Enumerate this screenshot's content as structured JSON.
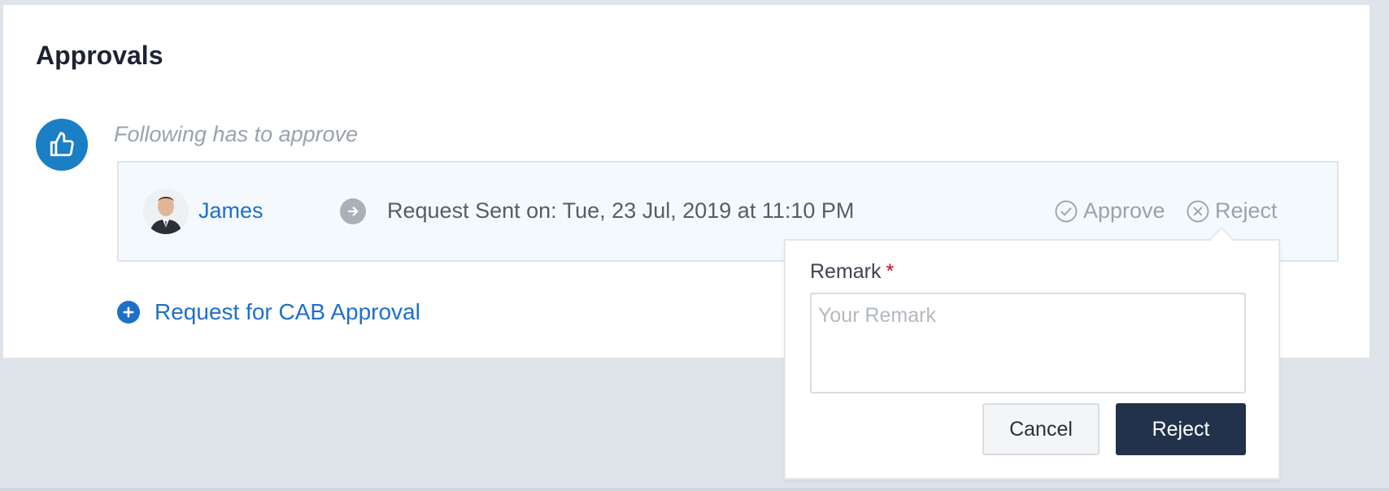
{
  "section": {
    "title": "Approvals",
    "hint": "Following has to approve"
  },
  "approval": {
    "approver_name": "James",
    "request_sent": "Request Sent on: Tue, 23 Jul, 2019 at 11:10 PM",
    "approve_label": "Approve",
    "reject_label": "Reject"
  },
  "add_request": {
    "label": "Request for CAB Approval"
  },
  "reject_popover": {
    "remark_label": "Remark",
    "required_mark": "*",
    "remark_placeholder": "Your Remark",
    "remark_value": "",
    "cancel_label": "Cancel",
    "reject_label": "Reject"
  },
  "icons": {
    "approval_icon": "thumbs-up-icon",
    "arrow_icon": "arrow-right-icon",
    "approve_icon": "check-circle-icon",
    "reject_icon": "x-circle-icon",
    "add_icon": "plus-circle-icon"
  },
  "colors": {
    "accent": "#1f6fc9",
    "approval_badge": "#1a7fc4",
    "primary_button": "#22324a",
    "required": "#d0021b",
    "muted": "#9aa3ad"
  }
}
